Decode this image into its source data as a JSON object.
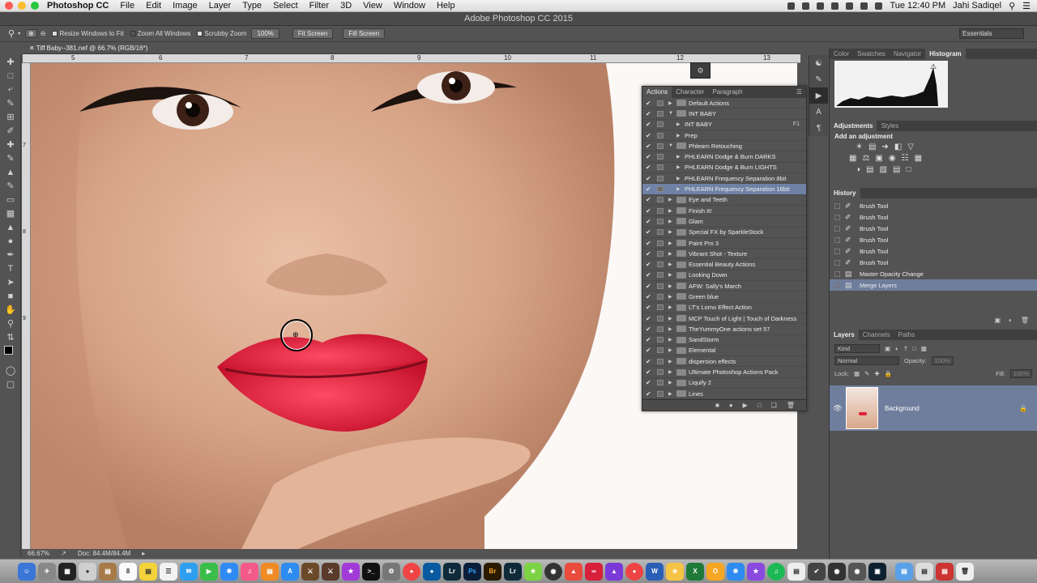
{
  "menubar": {
    "app_name": "Photoshop CC",
    "items": [
      "File",
      "Edit",
      "Image",
      "Layer",
      "Type",
      "Select",
      "Filter",
      "3D",
      "View",
      "Window",
      "Help"
    ],
    "clock": "Tue 12:40 PM",
    "user": "Jahi Sadiqel"
  },
  "window": {
    "title": "Adobe Photoshop CC 2015"
  },
  "options": {
    "resize_windows": "Resize Windows to Fit",
    "zoom_all": "Zoom All Windows",
    "scrubby": "Scrubby Zoom",
    "zoom_pct": "100%",
    "fit_screen": "Fit Screen",
    "fill_screen": "Fill Screen",
    "workspace": "Essentials"
  },
  "document": {
    "tab": "Tiff Baby--381.nef @ 66.7% (RGB/16*)",
    "zoom": "66.67%",
    "doc_size": "Doc: 84.4M/84.4M"
  },
  "ruler": {
    "h_labels": [
      "5",
      "6",
      "7",
      "8",
      "9",
      "10",
      "11",
      "12",
      "13"
    ],
    "v_labels": [
      "7",
      "8",
      "9"
    ]
  },
  "actions_panel": {
    "tabs": [
      "Actions",
      "Character",
      "Paragraph"
    ],
    "rows": [
      {
        "label": "Default Actions",
        "indent": 0,
        "kind": "set"
      },
      {
        "label": "INT BABY",
        "indent": 0,
        "kind": "set-open"
      },
      {
        "label": "INT BABY",
        "indent": 1,
        "kind": "action",
        "fkey": "F1"
      },
      {
        "label": "Prep",
        "indent": 1,
        "kind": "action"
      },
      {
        "label": "Phlearn Retouching",
        "indent": 0,
        "kind": "set-open"
      },
      {
        "label": "PHLEARN Dodge & Burn DARKS",
        "indent": 1,
        "kind": "action"
      },
      {
        "label": "PHLEARN Dodge & Burn LIGHTS",
        "indent": 1,
        "kind": "action"
      },
      {
        "label": "PHLEARN Frequency Separation 8bit",
        "indent": 1,
        "kind": "action"
      },
      {
        "label": "PHLEARN Frequency Separation 16bit",
        "indent": 1,
        "kind": "action",
        "selected": true
      },
      {
        "label": "Eye and Teeth",
        "indent": 0,
        "kind": "set"
      },
      {
        "label": "Finish It!",
        "indent": 0,
        "kind": "set"
      },
      {
        "label": "Glam",
        "indent": 0,
        "kind": "set"
      },
      {
        "label": "Special FX by SparkleStock",
        "indent": 0,
        "kind": "set"
      },
      {
        "label": "Paint Pro 3",
        "indent": 0,
        "kind": "set"
      },
      {
        "label": "Vibrant Shot - Texture",
        "indent": 0,
        "kind": "set"
      },
      {
        "label": "Essential Beauty Actions",
        "indent": 0,
        "kind": "set"
      },
      {
        "label": "Looking Down",
        "indent": 0,
        "kind": "set"
      },
      {
        "label": "AFW: Sally's March",
        "indent": 0,
        "kind": "set"
      },
      {
        "label": "Green blue",
        "indent": 0,
        "kind": "set"
      },
      {
        "label": "LT's Lomo Effect Action",
        "indent": 0,
        "kind": "set"
      },
      {
        "label": "MCP Touch of Light | Touch of Darkness",
        "indent": 0,
        "kind": "set"
      },
      {
        "label": "TheYummyOne actions set 57",
        "indent": 0,
        "kind": "set"
      },
      {
        "label": "SandStorm",
        "indent": 0,
        "kind": "set"
      },
      {
        "label": "Elemental",
        "indent": 0,
        "kind": "set"
      },
      {
        "label": "dispersion effects",
        "indent": 0,
        "kind": "set"
      },
      {
        "label": "Ultimate Photoshop Actions Pack",
        "indent": 0,
        "kind": "set"
      },
      {
        "label": "Liquify 2",
        "indent": 0,
        "kind": "set"
      },
      {
        "label": "Lines",
        "indent": 0,
        "kind": "set"
      }
    ]
  },
  "top_panel": {
    "tabs": [
      "Color",
      "Swatches",
      "Navigator",
      "Histogram"
    ]
  },
  "adjustments": {
    "tabs": [
      "Adjustments",
      "Styles"
    ],
    "heading": "Add an adjustment"
  },
  "history": {
    "title": "History",
    "rows": [
      {
        "label": "Brush Tool",
        "icon": "brush"
      },
      {
        "label": "Brush Tool",
        "icon": "brush"
      },
      {
        "label": "Brush Tool",
        "icon": "brush"
      },
      {
        "label": "Brush Tool",
        "icon": "brush"
      },
      {
        "label": "Brush Tool",
        "icon": "brush"
      },
      {
        "label": "Brush Tool",
        "icon": "brush"
      },
      {
        "label": "Master Opacity Change",
        "icon": "doc"
      },
      {
        "label": "Merge Layers",
        "icon": "doc",
        "selected": true
      }
    ]
  },
  "layers": {
    "tabs": [
      "Layers",
      "Channels",
      "Paths"
    ],
    "kind": "Kind",
    "blend": "Normal",
    "opacity_label": "Opacity:",
    "opacity": "100%",
    "lock_label": "Lock:",
    "fill_label": "Fill:",
    "fill": "100%",
    "layer_name": "Background"
  },
  "colors": {
    "selection": "#6f82a6",
    "lip": "#e0203a",
    "skin": "#d9a78a"
  }
}
